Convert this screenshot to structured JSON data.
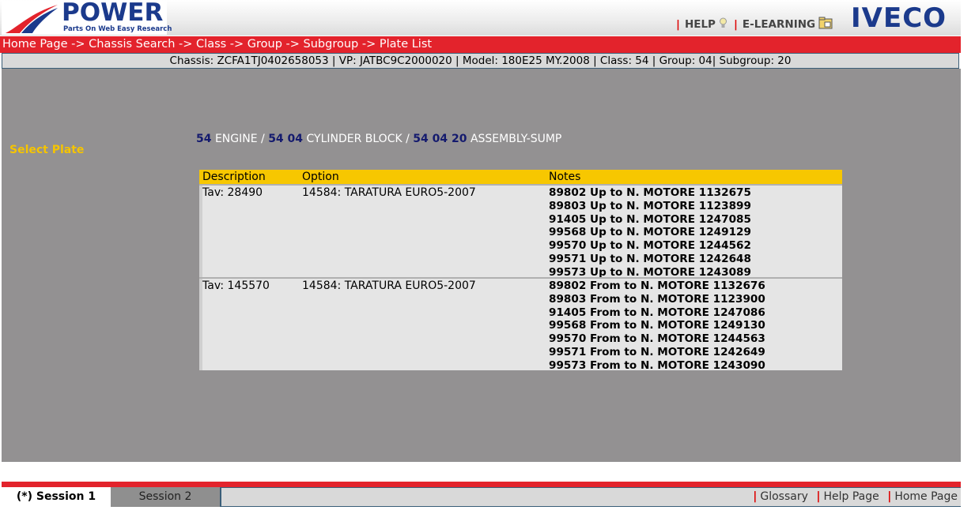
{
  "header": {
    "logo_text": "POWER",
    "logo_tagline": "Parts On Web Easy Research",
    "help_label": "HELP",
    "elearning_label": "E-LEARNING",
    "brand": "IVECO"
  },
  "breadcrumb": "Home Page -> Chassis Search -> Class -> Group -> Subgroup -> Plate List",
  "chassis_info": "Chassis: ZCFA1TJ0402658053 | VP: JATBC9C2000020 | Model: 180E25 MY.2008 | Class: 54 | Group: 04| Subgroup: 20",
  "sidebar": {
    "select_plate": "Select Plate"
  },
  "plate_path": {
    "class_code": "54",
    "class_name": "ENGINE",
    "group_code": "54 04",
    "group_name": "CYLINDER BLOCK",
    "subgroup_code": "54 04 20",
    "subgroup_name": "ASSEMBLY-SUMP",
    "separator": "/"
  },
  "table": {
    "headers": {
      "description": "Description",
      "option": "Option",
      "notes": "Notes"
    },
    "rows": [
      {
        "description": "Tav: 28490",
        "option": "14584:   TARATURA EURO5-2007",
        "notes": [
          "89802 Up to N. MOTORE 1132675",
          "89803 Up to N. MOTORE 1123899",
          "91405 Up to N. MOTORE 1247085",
          "99568 Up to N. MOTORE 1249129",
          "99570 Up to N. MOTORE 1244562",
          "99571 Up to N. MOTORE 1242648",
          "99573 Up to N. MOTORE 1243089"
        ]
      },
      {
        "description": "Tav: 145570",
        "option": "14584:   TARATURA EURO5-2007",
        "notes": [
          "89802 From to N. MOTORE 1132676",
          "89803 From to N. MOTORE 1123900",
          "91405 From to N. MOTORE 1247086",
          "99568 From to N. MOTORE 1249130",
          "99570 From to N. MOTORE 1244563",
          "99571 From to N. MOTORE 1242649",
          "99573 From to N. MOTORE 1243090"
        ]
      }
    ]
  },
  "sessions": {
    "session_1": "(*) Session 1",
    "session_2": "Session 2"
  },
  "footer": {
    "glossary": "Glossary",
    "help_page": "Help Page",
    "home_page": "Home Page"
  },
  "colors": {
    "red": "#e3232c",
    "yellow": "#f7c700",
    "navy": "#141a6e",
    "brand_blue": "#1b3a8c",
    "gray_panel": "#939192"
  }
}
